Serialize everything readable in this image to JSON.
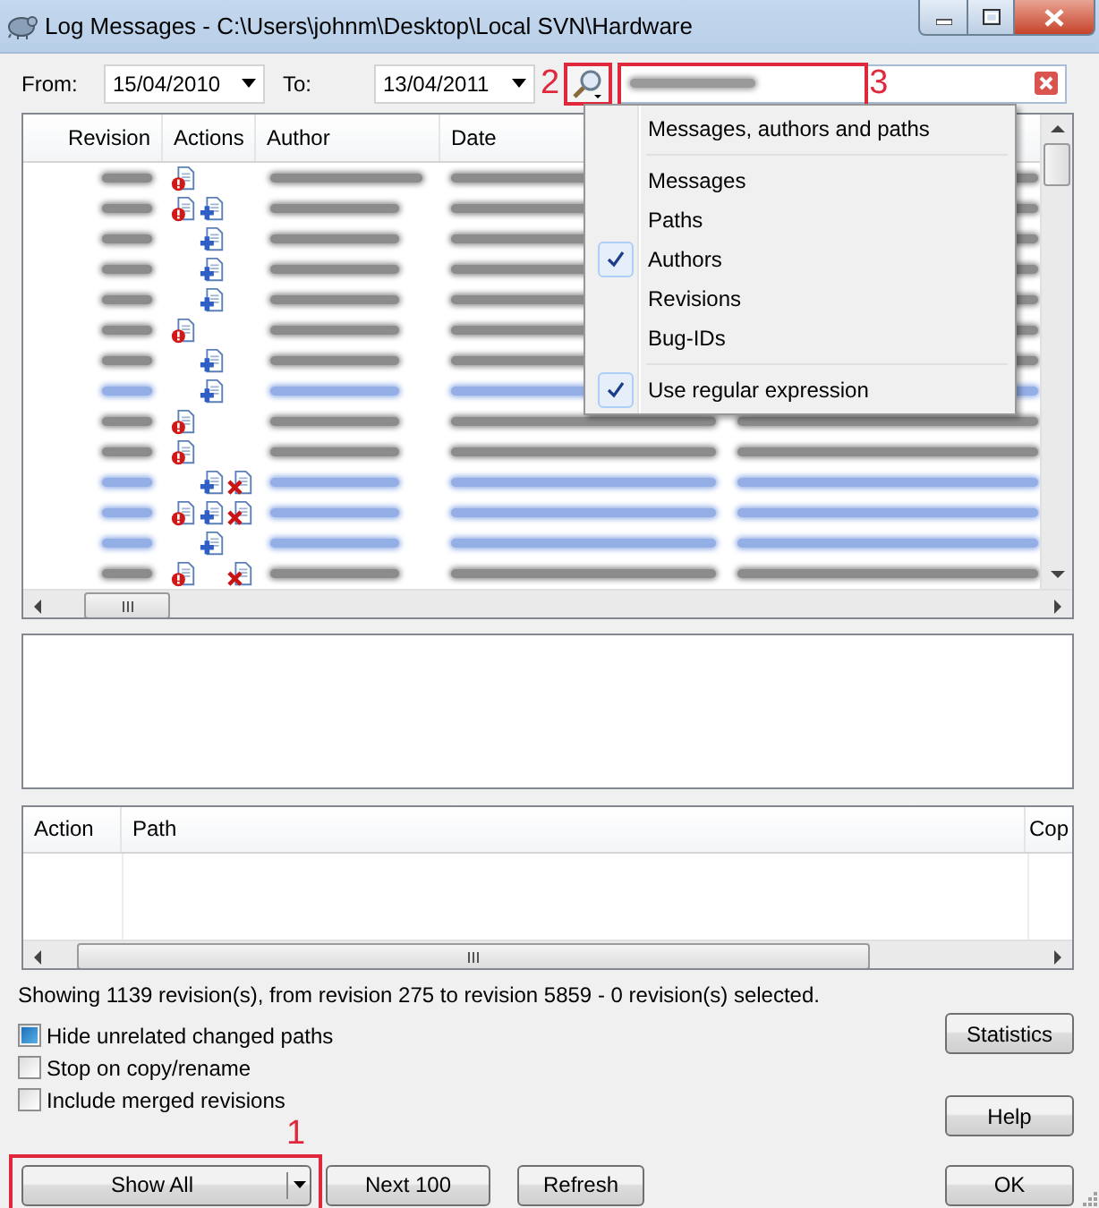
{
  "window": {
    "title": "Log Messages - C:\\Users\\johnm\\Desktop\\Local SVN\\Hardware"
  },
  "filters": {
    "from_label": "From:",
    "from_value": "15/04/2010",
    "to_label": "To:",
    "to_value": "13/04/2011"
  },
  "log_table": {
    "columns": [
      "Revision",
      "Actions",
      "Author",
      "Date"
    ],
    "rows": [
      {
        "modified": true,
        "added": false,
        "deleted": false,
        "color": "#8c8c8c"
      },
      {
        "modified": true,
        "added": true,
        "deleted": false,
        "color": "#8c8c8c"
      },
      {
        "modified": false,
        "added": true,
        "deleted": false,
        "color": "#8c8c8c"
      },
      {
        "modified": false,
        "added": true,
        "deleted": false,
        "color": "#8c8c8c"
      },
      {
        "modified": false,
        "added": true,
        "deleted": false,
        "color": "#8c8c8c"
      },
      {
        "modified": true,
        "added": false,
        "deleted": false,
        "color": "#8c8c8c"
      },
      {
        "modified": false,
        "added": true,
        "deleted": false,
        "color": "#8c8c8c"
      },
      {
        "modified": false,
        "added": true,
        "deleted": false,
        "color": "#94aee6"
      },
      {
        "modified": true,
        "added": false,
        "deleted": false,
        "color": "#8c8c8c"
      },
      {
        "modified": true,
        "added": false,
        "deleted": false,
        "color": "#8c8c8c"
      },
      {
        "modified": false,
        "added": true,
        "deleted": true,
        "color": "#94aee6"
      },
      {
        "modified": true,
        "added": true,
        "deleted": true,
        "color": "#94aee6"
      },
      {
        "modified": false,
        "added": true,
        "deleted": false,
        "color": "#94aee6"
      },
      {
        "modified": true,
        "added": false,
        "deleted": true,
        "color": "#8c8c8c"
      }
    ]
  },
  "search_menu": {
    "sections": [
      [
        {
          "label": "Messages, authors and paths",
          "checked": false
        }
      ],
      [
        {
          "label": "Messages",
          "checked": false
        },
        {
          "label": "Paths",
          "checked": false
        },
        {
          "label": "Authors",
          "checked": true
        },
        {
          "label": "Revisions",
          "checked": false
        },
        {
          "label": "Bug-IDs",
          "checked": false
        }
      ],
      [
        {
          "label": "Use regular expression",
          "checked": true
        }
      ]
    ]
  },
  "paths_table": {
    "columns": [
      "Action",
      "Path",
      "Cop"
    ]
  },
  "status": "Showing 1139 revision(s), from revision 275 to revision 5859 - 0 revision(s) selected.",
  "options": [
    {
      "label": "Hide unrelated changed paths",
      "checked": true
    },
    {
      "label": "Stop on copy/rename",
      "checked": false
    },
    {
      "label": "Include merged revisions",
      "checked": false
    }
  ],
  "side_buttons": [
    "Statistics",
    "Help"
  ],
  "bottom_buttons": [
    {
      "label": "Show All",
      "kind": "split"
    },
    {
      "label": "Next 100",
      "kind": "plain"
    },
    {
      "label": "Refresh",
      "kind": "plain"
    }
  ],
  "ok_button": "OK",
  "annotations": [
    "1",
    "2",
    "3"
  ]
}
